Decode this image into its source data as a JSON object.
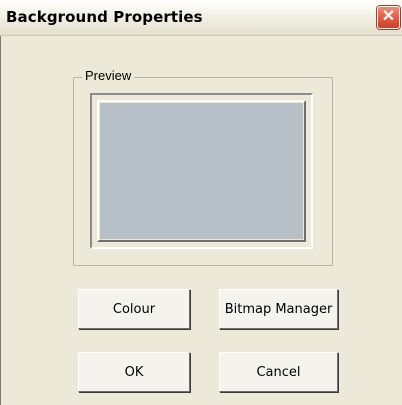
{
  "window": {
    "title": "Background Properties",
    "close_glyph": "✕",
    "close_icon": "close-icon"
  },
  "preview": {
    "group_label": "Preview",
    "fill_color": "#b8c0c7"
  },
  "buttons": {
    "colour": "Colour",
    "bitmap_manager": "Bitmap Manager",
    "ok": "OK",
    "cancel": "Cancel"
  }
}
